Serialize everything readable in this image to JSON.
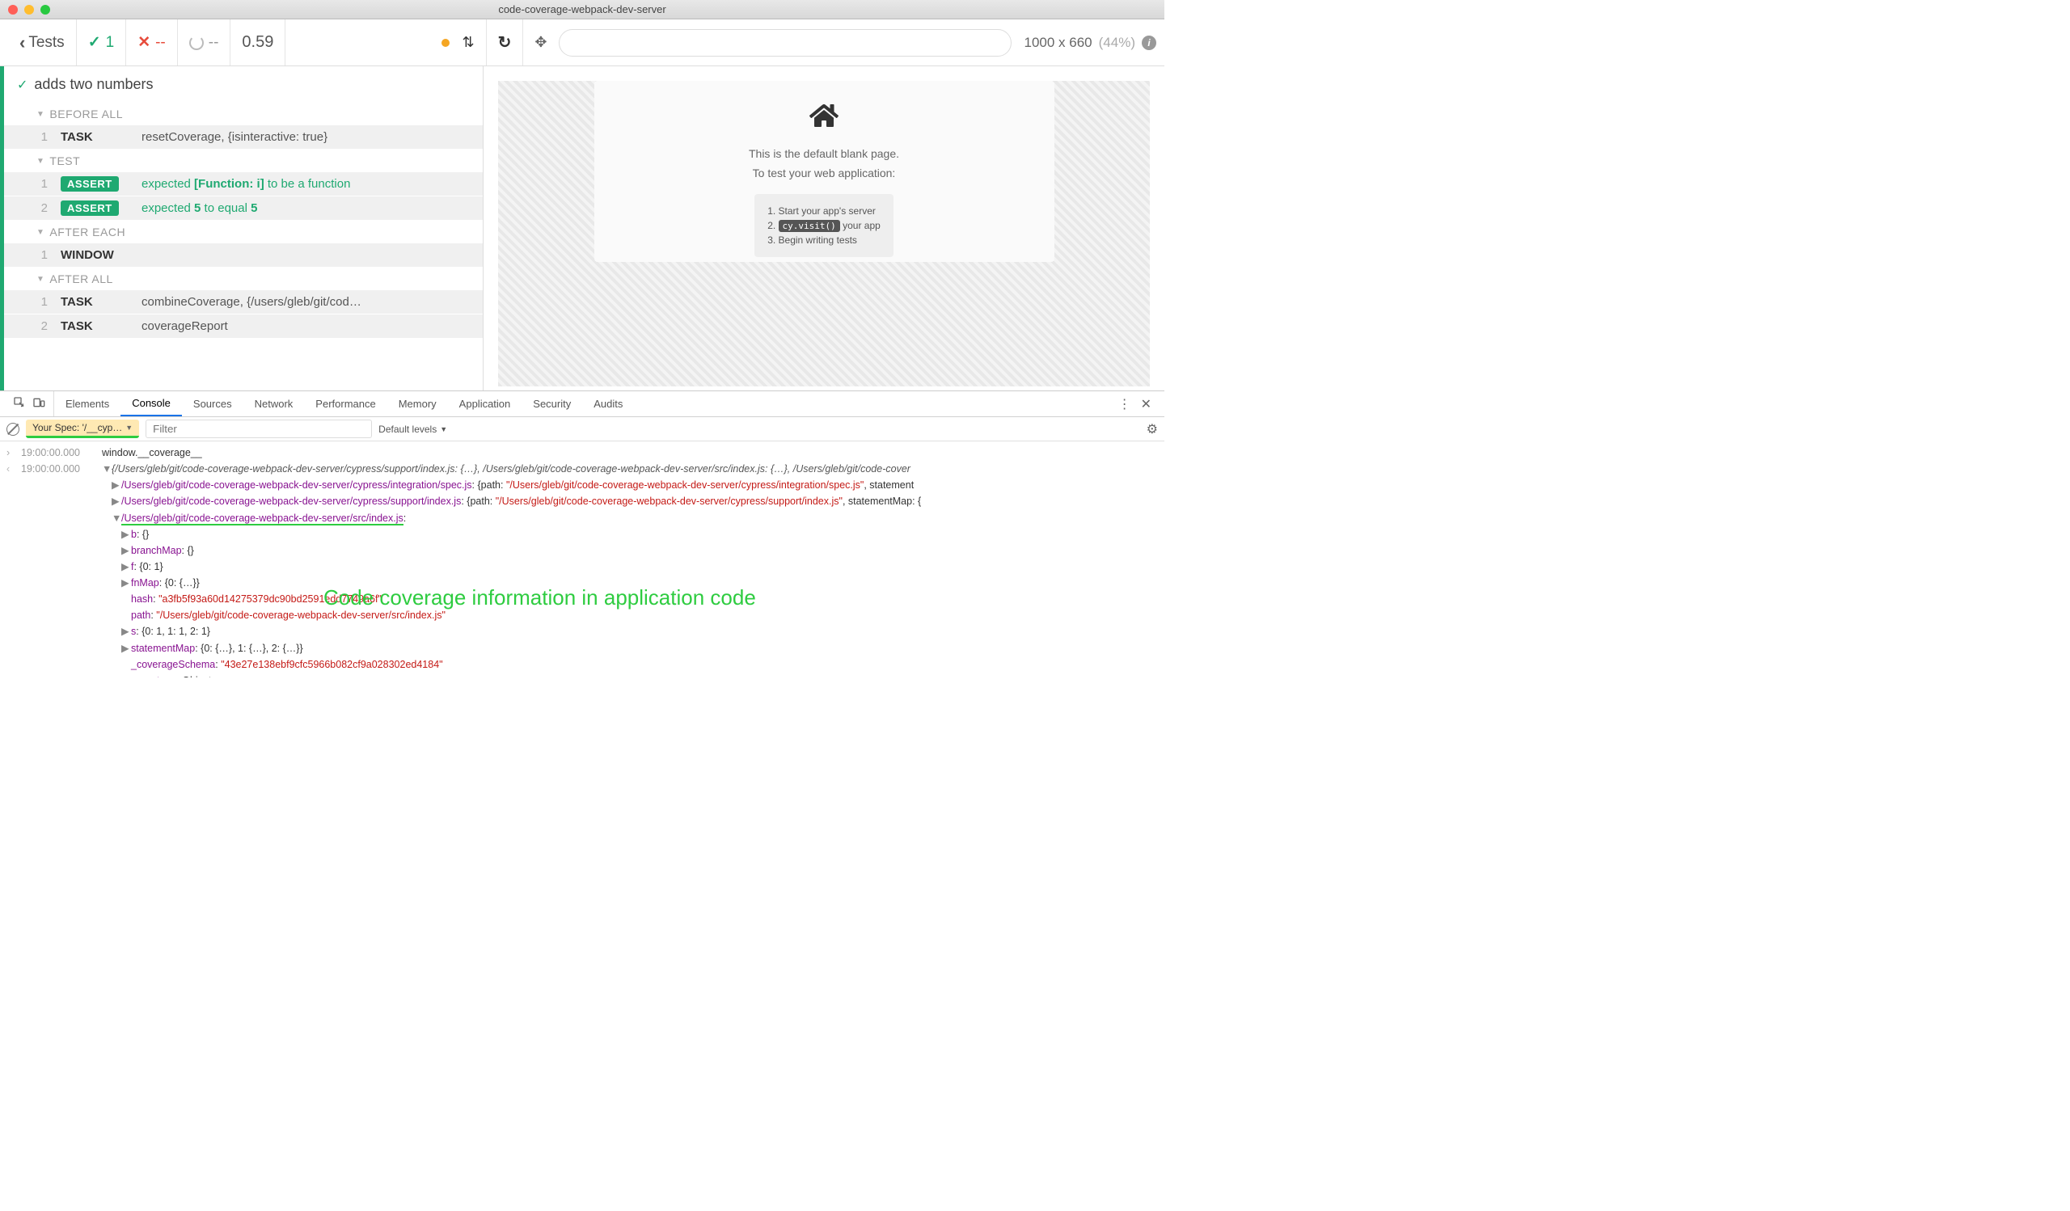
{
  "window": {
    "title": "code-coverage-webpack-dev-server"
  },
  "topbar": {
    "back": "Tests",
    "passed": "1",
    "failed": "--",
    "pending": "--",
    "duration": "0.59",
    "viewport": "1000 x 660",
    "percent": "(44%)"
  },
  "reporter": {
    "test_title": "adds two numbers",
    "hooks": {
      "before_all": "BEFORE ALL",
      "test": "TEST",
      "after_each": "AFTER EACH",
      "after_all": "AFTER ALL"
    },
    "cmds": {
      "resetCoverage": {
        "num": "1",
        "name": "TASK",
        "msg": "resetCoverage, {isinteractive: true}"
      },
      "assert1": {
        "num": "1",
        "badge": "ASSERT",
        "prefix": "expected ",
        "mid": "[Function: i]",
        "suffix": " to be a function"
      },
      "assert2": {
        "num": "2",
        "badge": "ASSERT",
        "prefix": "expected ",
        "v1": "5",
        "mid": " to equal ",
        "v2": "5"
      },
      "window": {
        "num": "1",
        "name": "WINDOW",
        "msg": ""
      },
      "combine": {
        "num": "1",
        "name": "TASK",
        "msg": "combineCoverage, {/users/gleb/git/cod…"
      },
      "report": {
        "num": "2",
        "name": "TASK",
        "msg": "coverageReport"
      }
    }
  },
  "aut": {
    "line1": "This is the default blank page.",
    "line2": "To test your web application:",
    "steps": {
      "s1": "Start your app's server",
      "s2a": "cy.visit()",
      "s2b": " your app",
      "s3": "Begin writing tests"
    }
  },
  "devtools": {
    "tabs": {
      "elements": "Elements",
      "console": "Console",
      "sources": "Sources",
      "network": "Network",
      "performance": "Performance",
      "memory": "Memory",
      "application": "Application",
      "security": "Security",
      "audits": "Audits"
    },
    "context": "Your Spec: '/__cyp…",
    "filter_placeholder": "Filter",
    "levels": "Default levels",
    "console": {
      "l1_time": "19:00:00.000",
      "l1_text": "window.__coverage__",
      "l2_time": "19:00:00.000",
      "l2_summary": "{/Users/gleb/git/code-coverage-webpack-dev-server/cypress/support/index.js: {…}, /Users/gleb/git/code-coverage-webpack-dev-server/src/index.js: {…}, /Users/gleb/git/code-cover",
      "l3_key": "/Users/gleb/git/code-coverage-webpack-dev-server/cypress/integration/spec.js",
      "l3_path_label": "{path: ",
      "l3_path": "\"/Users/gleb/git/code-coverage-webpack-dev-server/cypress/integration/spec.js\"",
      "l3_suffix": ", statement",
      "l4_key": "/Users/gleb/git/code-coverage-webpack-dev-server/cypress/support/index.js",
      "l4_path": "\"/Users/gleb/git/code-coverage-webpack-dev-server/cypress/support/index.js\"",
      "l4_suffix": ", statementMap: {",
      "l5_key": "/Users/gleb/git/code-coverage-webpack-dev-server/src/index.js",
      "b_key": "b",
      "b_val": ": {}",
      "branchMap_key": "branchMap",
      "branchMap_val": ": {}",
      "f_key": "f",
      "f_val": ": {0: 1}",
      "fnMap_key": "fnMap",
      "fnMap_val": ": {0: {…}}",
      "hash_key": "hash",
      "hash_val": "\"a3fb5f93a60d14275379dc90bd2591edd7749a6f\"",
      "path_key": "path",
      "path_val": "\"/Users/gleb/git/code-coverage-webpack-dev-server/src/index.js\"",
      "s_key": "s",
      "s_val": ": {0: 1, 1: 1, 2: 1}",
      "stmtMap_key": "statementMap",
      "stmtMap_val": ": {0: {…}, 1: {…}, 2: {…}}",
      "schema_key": "_coverageSchema",
      "schema_val": "\"43e27e138ebf9cfc5966b082cf9a028302ed4184\"",
      "proto_key": "__proto__",
      "proto_val": ": Object"
    }
  },
  "annotation": "Code coverage information in application code"
}
